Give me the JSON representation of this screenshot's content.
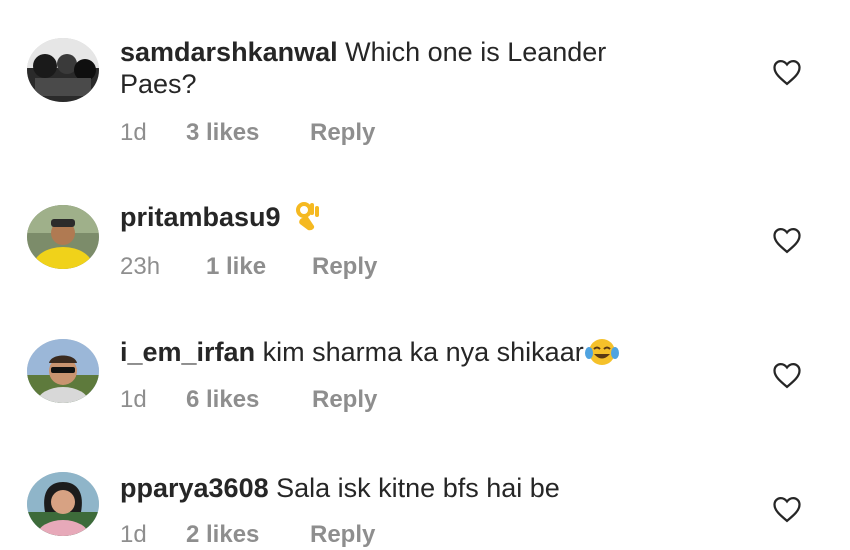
{
  "comments": [
    {
      "username": "samdarshkanwal",
      "text": "Which one is Leander",
      "text2": "Paes?",
      "time": "1d",
      "likes": "3 likes",
      "reply": "Reply",
      "emoji": ""
    },
    {
      "username": "pritambasu9",
      "text": "",
      "text2": "",
      "time": "23h",
      "likes": "1 like",
      "reply": "Reply",
      "emoji": "ok-hand-emoji"
    },
    {
      "username": "i_em_irfan",
      "text": "kim sharma ka nya shikaar",
      "text2": "",
      "time": "1d",
      "likes": "6 likes",
      "reply": "Reply",
      "emoji": "tears-of-joy-emoji"
    },
    {
      "username": "pparya3608",
      "text": "Sala isk kitne bfs hai be",
      "text2": "",
      "time": "1d",
      "likes": "2 likes",
      "reply": "Reply",
      "emoji": ""
    }
  ],
  "icons": {
    "like": "heart-outline-icon"
  },
  "colors": {
    "text": "#262626",
    "meta": "#8e8e8e",
    "background": "#ffffff"
  }
}
